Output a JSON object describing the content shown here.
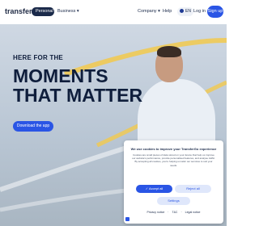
{
  "header": {
    "logo": {
      "mark": "transfer",
      "suffix": "Go"
    },
    "segments": {
      "personal": "Personal",
      "business": "Business"
    },
    "nav": {
      "company": "Company",
      "help": "Help"
    },
    "lang": "EN",
    "login": "Log in",
    "signup": "Sign up"
  },
  "hero": {
    "kicker": "HERE FOR THE",
    "headline_line1": "MOMENTS",
    "headline_line2": "THAT MATTER",
    "cta": "Download the app"
  },
  "cookie": {
    "title": "We use cookies to improve your TransferGo experience",
    "body": "Cookies are small pieces of data stored on your device that help us improve our website's performance, provide personalised features, and analyse traffic. By accepting all cookies, you're helping us tailor our services to suit your needs.",
    "accept": "Accept all",
    "reject": "Reject all",
    "settings": "Settings",
    "links": [
      "Privacy notice",
      "T&C",
      "Legal notice"
    ]
  },
  "colors": {
    "brand_blue": "#2a55e5",
    "navy": "#0f1e3c",
    "curve_yellow": "#f2c94c"
  }
}
